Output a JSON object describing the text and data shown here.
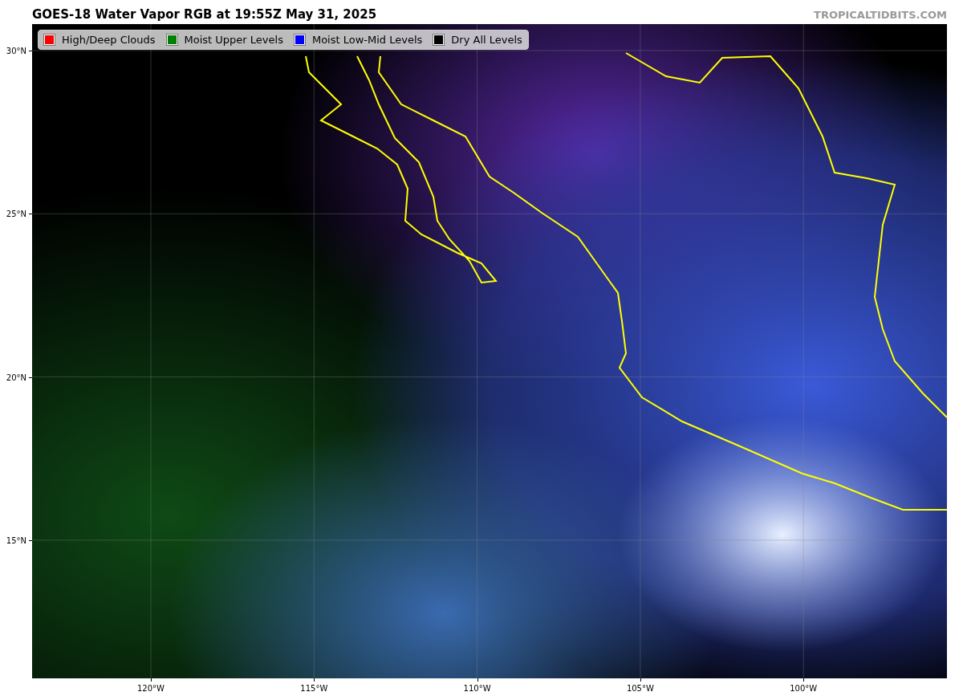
{
  "title": "GOES-18 Water Vapor RGB at 19:55Z May 31, 2025",
  "source": "TROPICALTIDBITS.COM",
  "legend": [
    {
      "label": "High/Deep Clouds",
      "color": "#ff0000"
    },
    {
      "label": "Moist Upper Levels",
      "color": "#008000"
    },
    {
      "label": "Moist Low-Mid Levels",
      "color": "#0000ff"
    },
    {
      "label": "Dry All Levels",
      "color": "#000000"
    }
  ],
  "map": {
    "y_axis_labels": [
      "30°N",
      "25°N",
      "20°N",
      "15°N"
    ],
    "x_axis_labels": [
      "120°W",
      "115°W",
      "110°W",
      "105°W",
      "100°W"
    ]
  }
}
